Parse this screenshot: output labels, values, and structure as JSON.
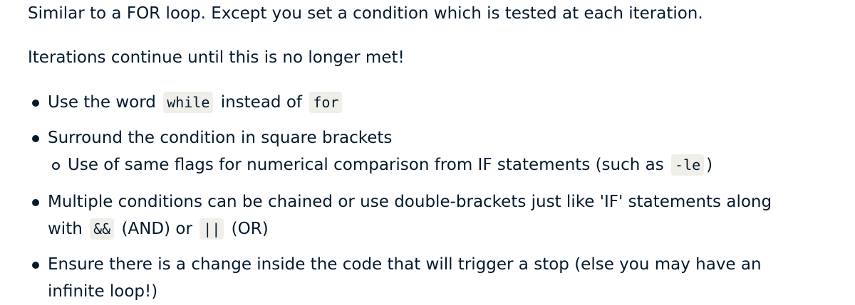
{
  "intro": {
    "line1": "Similar to a FOR loop. Except you set a condition which is tested at each iteration.",
    "line2": "Iterations continue until this is no longer met!"
  },
  "bullets": {
    "b1": {
      "text_a": "Use the word",
      "code_a": "while",
      "text_b": "instead of",
      "code_b": "for"
    },
    "b2": {
      "text": "Surround the condition in square brackets",
      "sub": {
        "text_a": "Use of same flags for numerical comparison from IF statements (such as",
        "code": "-le",
        "text_b": ")"
      }
    },
    "b3": {
      "line1": "Multiple conditions can be chained or use double-brackets just like 'IF' statements along",
      "text_with": "with",
      "code_and": "&&",
      "text_and": "(AND) or",
      "code_or": "||",
      "text_or": "(OR)"
    },
    "b4": {
      "line1": "Ensure there is a change inside the code that will trigger a stop (else you may have an",
      "line2": "infinite loop!)"
    }
  }
}
